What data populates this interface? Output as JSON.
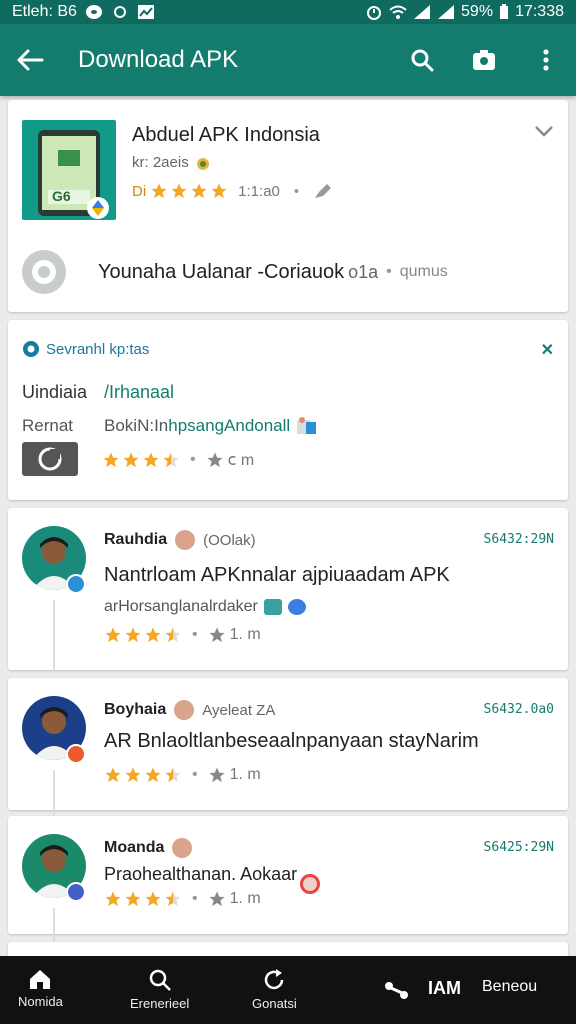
{
  "status_bar": {
    "left_text": "Etleh: B6",
    "battery": "59%",
    "time": "17:338"
  },
  "app_bar": {
    "title": "Download APK",
    "color": "#137c6e"
  },
  "app_card": {
    "name": "Abduel APK Indonsia",
    "sub": "kr: 2aeis",
    "meta_prefix": "Di",
    "meta_value": "1:1:a0",
    "rating": 4.5,
    "thumb_text": "G6",
    "developer_name": "Younaha Ualanar -Coriauok",
    "developer_suffix": "o1a",
    "developer_extra": "qumus"
  },
  "info_card": {
    "header": "Sevranhl kp:tas",
    "row1_label": "Uindiaia",
    "row1_value": "/Irhanaal",
    "row2_label": "Rernat",
    "row2_value_prefix": "BokiN:In",
    "row2_value": "hpsangAndonall",
    "rating": 3.5,
    "rating_value": "ⅽ m"
  },
  "reviews": [
    {
      "name": "Rauhdia",
      "tag": "(OOlak)",
      "code": "S6432:29N",
      "text": "Nantrloam APKnnalar ajpiuaadam APK",
      "sub": "arHorsanglanalrdaker",
      "rating": 3.5,
      "rating_value": "1. m",
      "badge_color": "#2b8fd6"
    },
    {
      "name": "Boyhaia",
      "tag": "Ayeleat ZA",
      "code": "S6432.0a0",
      "text": "AR Bnlaoltlanbeseaalnpanyaan stayNarim",
      "sub": "",
      "rating": 3.5,
      "rating_value": "1. m",
      "badge_color": "#ea5a2a"
    },
    {
      "name": "Moanda",
      "tag": "",
      "code": "S6425:29N",
      "text": "Praohealthanan. Aokaar",
      "sub": "",
      "rating": 3.5,
      "rating_value": "1. m",
      "badge_color": "#4460c8"
    }
  ],
  "bottom_nav": [
    {
      "label": "Nomida",
      "icon": "home-icon"
    },
    {
      "label": "Erenerieel",
      "icon": "search-icon"
    },
    {
      "label": "Gonatsi",
      "icon": "refresh-icon"
    },
    {
      "label": "",
      "icon": "connect-icon"
    },
    {
      "label": "IAM",
      "icon": "text"
    },
    {
      "label": "Beneou",
      "icon": "text"
    }
  ]
}
